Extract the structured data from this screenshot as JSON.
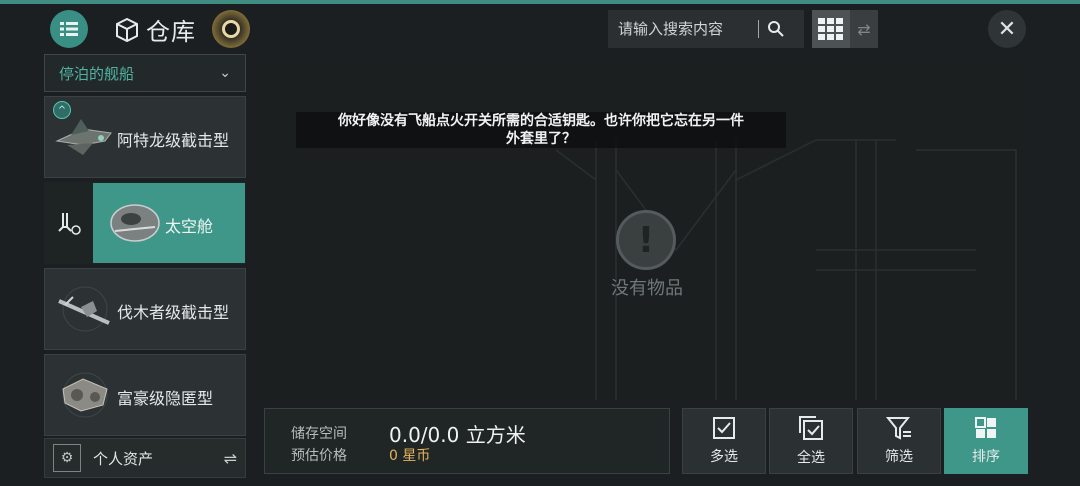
{
  "header": {
    "title": "仓库",
    "menu_icon": "menu-icon",
    "search_placeholder": "请输入搜索内容",
    "close_symbol": "✕",
    "list_symbol": "⇄"
  },
  "sidebar": {
    "dropdown_label": "停泊的舰船",
    "dropdown_chevron": "⌄",
    "ships": [
      {
        "name": "阿特龙级截击型",
        "badge": "^",
        "selected": false
      },
      {
        "name": "太空舱",
        "selected": true
      },
      {
        "name": "伐木者级截击型",
        "selected": false
      },
      {
        "name": "富豪级隐匿型",
        "selected": false
      }
    ],
    "assets_label": "个人资产",
    "assets_icon_glyph": "⚙",
    "assets_swap_glyph": "⇌"
  },
  "main": {
    "notice_line1": "你好像没有飞船点火开关所需的合适钥匙。也许你把它忘在另一件",
    "notice_line2": "外套里了？",
    "empty_glyph": "!",
    "empty_label": "没有物品"
  },
  "storage": {
    "space_label": "储存空间",
    "space_value": "0.0/0.0 立方米",
    "price_label": "预估价格",
    "price_value": "0 星币"
  },
  "actions": [
    {
      "label": "多选",
      "icon": "checkbox-icon"
    },
    {
      "label": "全选",
      "icon": "multi-checkbox-icon"
    },
    {
      "label": "筛选",
      "icon": "filter-icon"
    },
    {
      "label": "排序",
      "icon": "sort-grid-icon"
    }
  ],
  "colors": {
    "accent": "#3f978a",
    "dropdown_text": "#4fb3a2",
    "price": "#e2b55a"
  }
}
